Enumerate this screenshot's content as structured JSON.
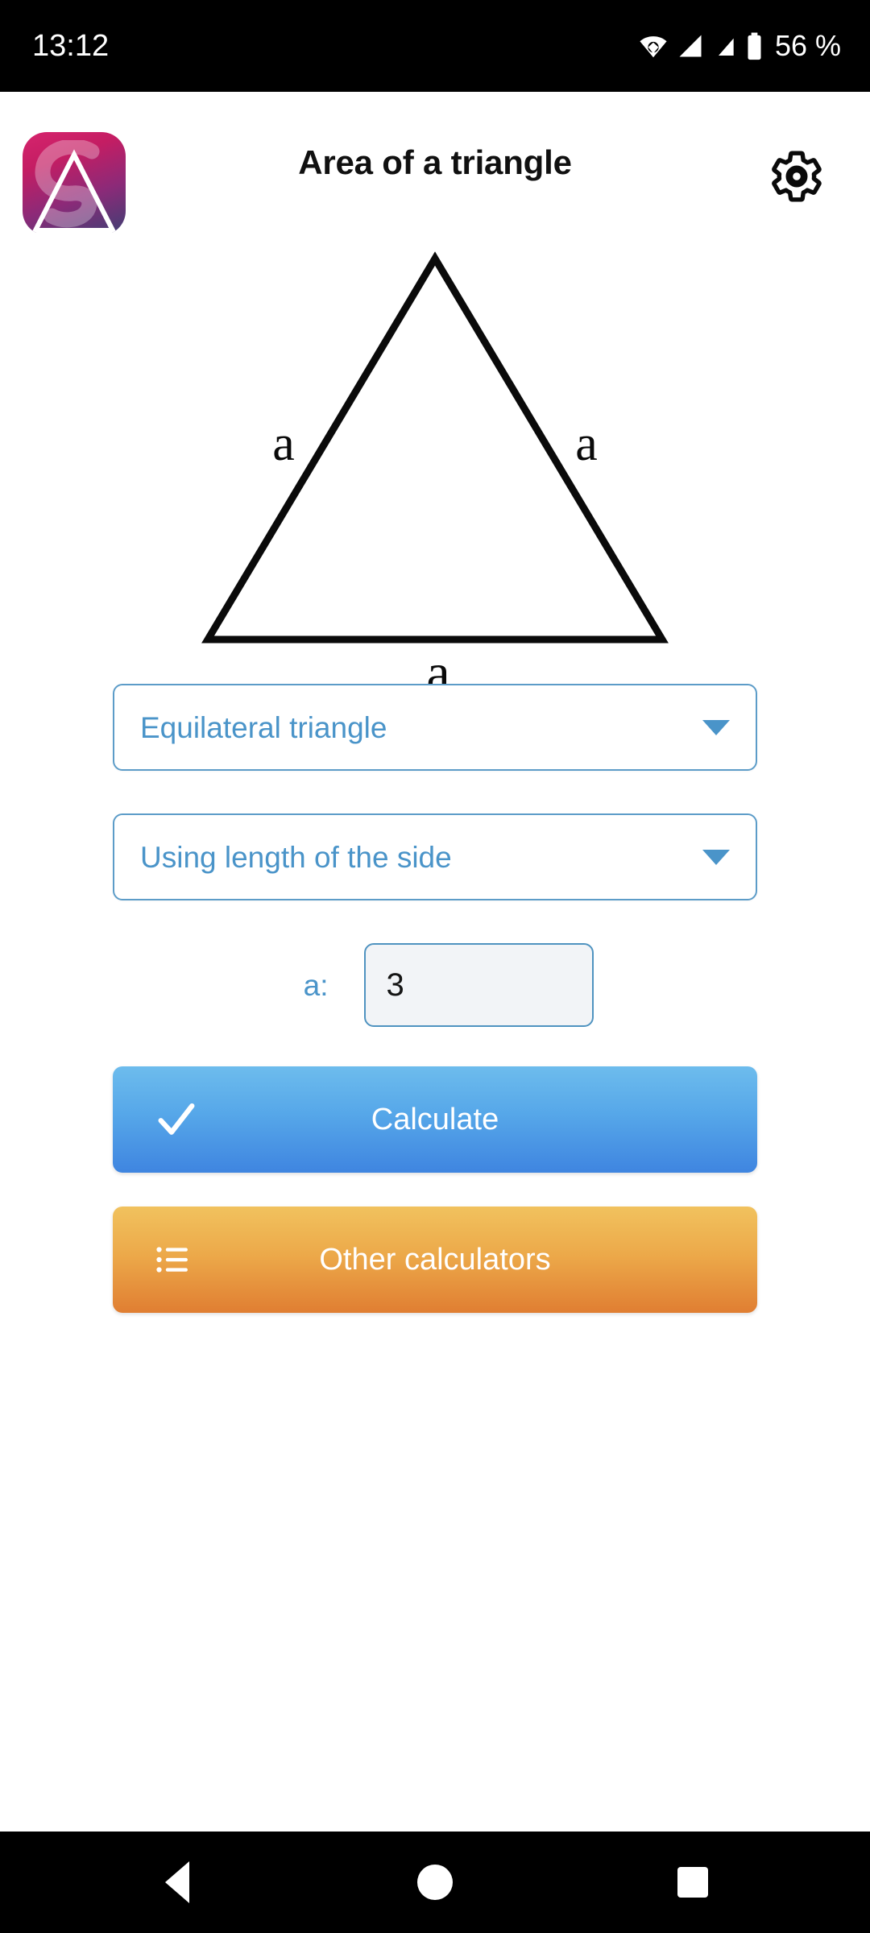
{
  "status_bar": {
    "time": "13:12",
    "battery_percent": "56 %",
    "icons": [
      "wifi-icon",
      "signal-icon",
      "signal-icon",
      "battery-icon"
    ]
  },
  "app_bar": {
    "title": "Area of a triangle",
    "app_icon_name": "app-logo-triangle",
    "settings_icon_name": "gear-icon"
  },
  "figure": {
    "shape": "equilateral-triangle",
    "label_left": "a",
    "label_right": "a",
    "label_bottom": "a",
    "stroke_color": "#0a0a0a"
  },
  "form": {
    "shape_dropdown": {
      "value": "Equilateral triangle",
      "caret_icon": "chevron-down-icon"
    },
    "method_dropdown": {
      "value": "Using length of the side",
      "caret_icon": "chevron-down-icon"
    },
    "side_input": {
      "label": "a:",
      "value": "3",
      "placeholder": ""
    }
  },
  "buttons": {
    "calculate": {
      "label": "Calculate",
      "icon": "check-icon",
      "color_top": "#6dbced",
      "color_bottom": "#3f85e0"
    },
    "other_calculators": {
      "label": "Other calculators",
      "icon": "list-icon",
      "color_top": "#f1c25e",
      "color_bottom": "#e07e32"
    }
  },
  "nav_bar": {
    "back": "back-icon",
    "home": "home-icon",
    "recents": "recents-icon"
  },
  "theme": {
    "accent_blue": "#4a94c9",
    "border_blue": "#5c9cc8",
    "background": "#ffffff"
  }
}
